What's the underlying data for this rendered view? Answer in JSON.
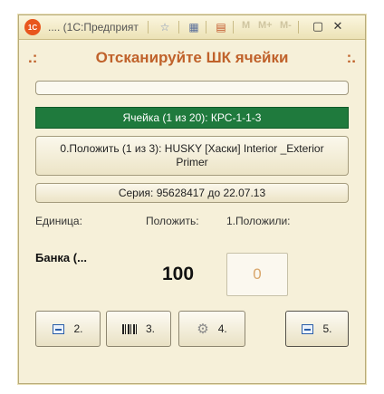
{
  "window": {
    "logo": "1С",
    "title": ".... (1С:Предприят",
    "toolbar_m": [
      "M",
      "M+",
      "M-"
    ]
  },
  "icons": {
    "app": "1c-logo-icon",
    "favorites": "star-icon",
    "calc": "calculator-icon",
    "calendar": "calendar-icon",
    "restore": "restore-icon",
    "close": "close-icon"
  },
  "header": {
    "left_mark": ".:",
    "title": "Отсканируйте ШК ячейки",
    "right_mark": ":."
  },
  "progress": {
    "value_fraction": 0.0
  },
  "cell": {
    "label": "Ячейка (1 из 20): КРС-1-1-3"
  },
  "task": {
    "text": "0.Положить (1 из 3): HUSKY [Хаски] Interior _Exterior Primer"
  },
  "series": {
    "text": "Серия: 95628417 до 22.07.13"
  },
  "labels": {
    "unit": "Единица:",
    "put": "Положить:",
    "placed": "1.Положили:"
  },
  "values": {
    "unit": "Банка (...",
    "put": "100",
    "placed": "0"
  },
  "buttons": [
    {
      "label": "2.",
      "icon": "back-icon"
    },
    {
      "label": "3.",
      "icon": "barcode-icon"
    },
    {
      "label": "4.",
      "icon": "gear-icon"
    },
    {
      "label": "5.",
      "icon": "forward-icon"
    }
  ],
  "colors": {
    "accent": "#c0622b",
    "cell_bg": "#1f7a3d",
    "window_bg": "#f6f0d9"
  }
}
